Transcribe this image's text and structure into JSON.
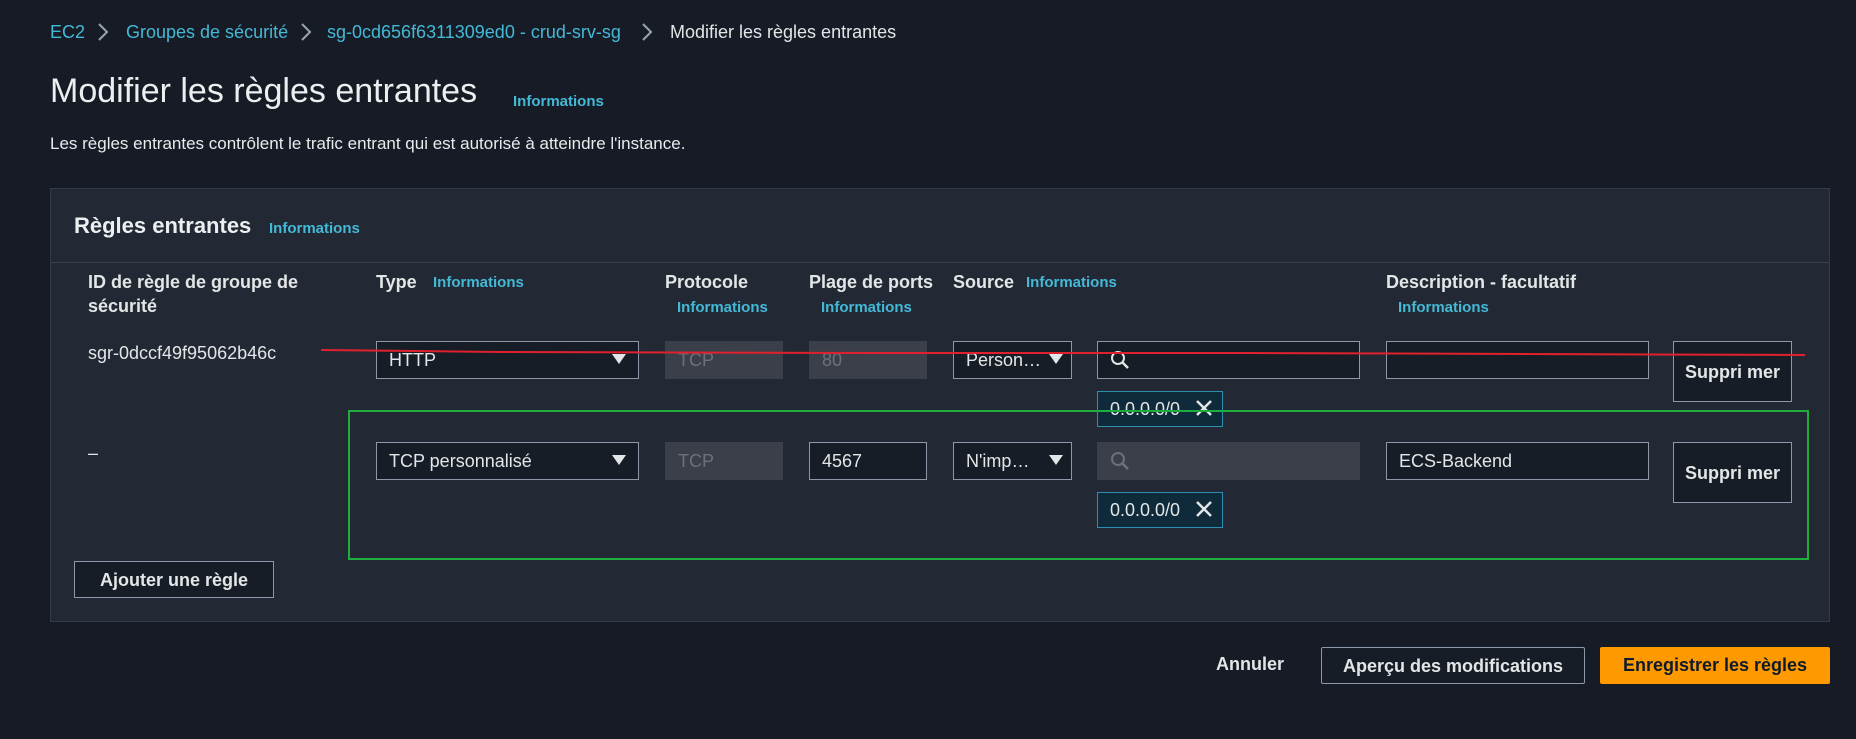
{
  "breadcrumb": {
    "items": [
      "EC2",
      "Groupes de sécurité",
      "sg-0cd656f6311309ed0 - crud-srv-sg"
    ],
    "current": "Modifier les règles entrantes"
  },
  "page": {
    "title": "Modifier les règles entrantes",
    "title_info": "Informations",
    "description": "Les règles entrantes contrôlent le trafic entrant qui est autorisé à atteindre l'instance."
  },
  "panel": {
    "title": "Règles entrantes",
    "title_info": "Informations",
    "columns": {
      "rule_id": "ID de règle de groupe de sécurité",
      "type": "Type",
      "type_info": "Informations",
      "protocol": "Protocole",
      "protocol_info": "Informations",
      "port_range": "Plage de ports",
      "port_range_info": "Informations",
      "source": "Source",
      "source_info": "Informations",
      "description": "Description - facultatif",
      "description_info": "Informations"
    },
    "rows": [
      {
        "rule_id": "sgr-0dccf49f95062b46c",
        "type": "HTTP",
        "protocol": "TCP",
        "port_range": "80",
        "source_type": "Person…",
        "source_search": "",
        "cidr": "0.0.0.0/0",
        "description": "",
        "delete_label": "Suppri mer"
      },
      {
        "rule_id": "–",
        "type": "TCP personnalisé",
        "protocol": "TCP",
        "port_range": "4567",
        "source_type": "N'imp…",
        "source_search": "",
        "cidr": "0.0.0.0/0",
        "description": "ECS-Backend",
        "delete_label": "Suppri mer"
      }
    ],
    "add_rule_label": "Ajouter une règle"
  },
  "footer": {
    "cancel_label": "Annuler",
    "preview_label": "Aperçu des modifications",
    "save_label": "Enregistrer les règles"
  },
  "annotations": {
    "strike_color": "#e0212d",
    "highlight_color": "#1fae3c"
  },
  "colors": {
    "link": "#44b9d6",
    "primary": "#ff9900",
    "background": "#161b25",
    "panel": "#232934"
  },
  "icons": [
    "chevron-right-icon",
    "caret-down-icon",
    "search-icon",
    "close-icon"
  ]
}
